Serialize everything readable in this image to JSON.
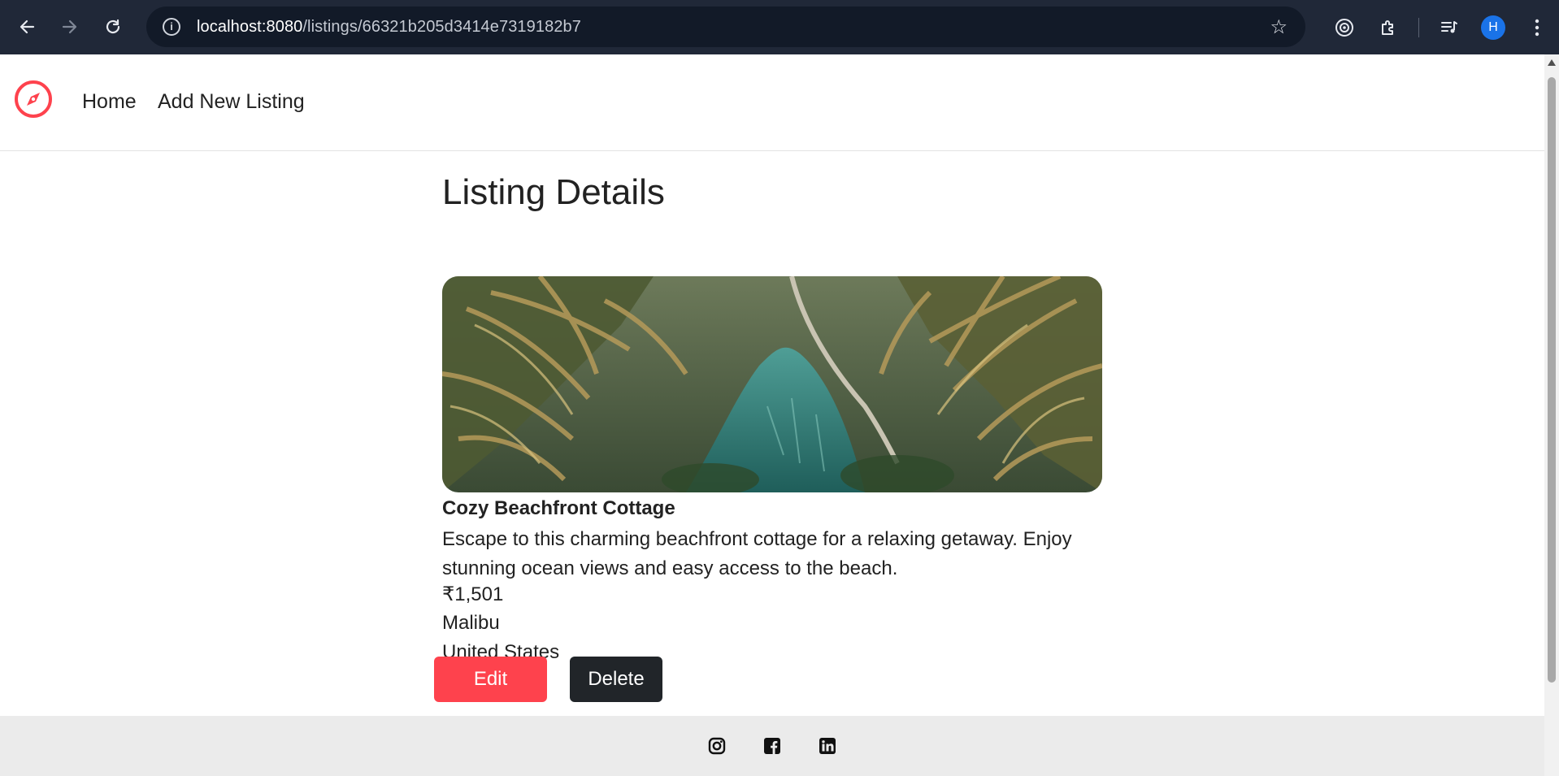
{
  "browser": {
    "url_host": "localhost:8080",
    "url_path": "/listings/66321b205d3414e7319182b7",
    "profile_initial": "H"
  },
  "navbar": {
    "home": "Home",
    "add_new": "Add New Listing"
  },
  "listing": {
    "page_title": "Listing Details",
    "name": "Cozy Beachfront Cottage",
    "description": "Escape to this charming beachfront cottage for a relaxing getaway. Enjoy stunning ocean views and easy access to the beach.",
    "price": "₹1,501",
    "city": "Malibu",
    "country": "United States"
  },
  "actions": {
    "edit": "Edit",
    "delete": "Delete"
  },
  "footer": {
    "icons": [
      "instagram-icon",
      "facebook-icon",
      "linkedin-icon"
    ]
  },
  "colors": {
    "brand": "#fe424d",
    "dark_button": "#212529",
    "footer_bg": "#ebebeb",
    "chrome_bg": "#202838"
  }
}
